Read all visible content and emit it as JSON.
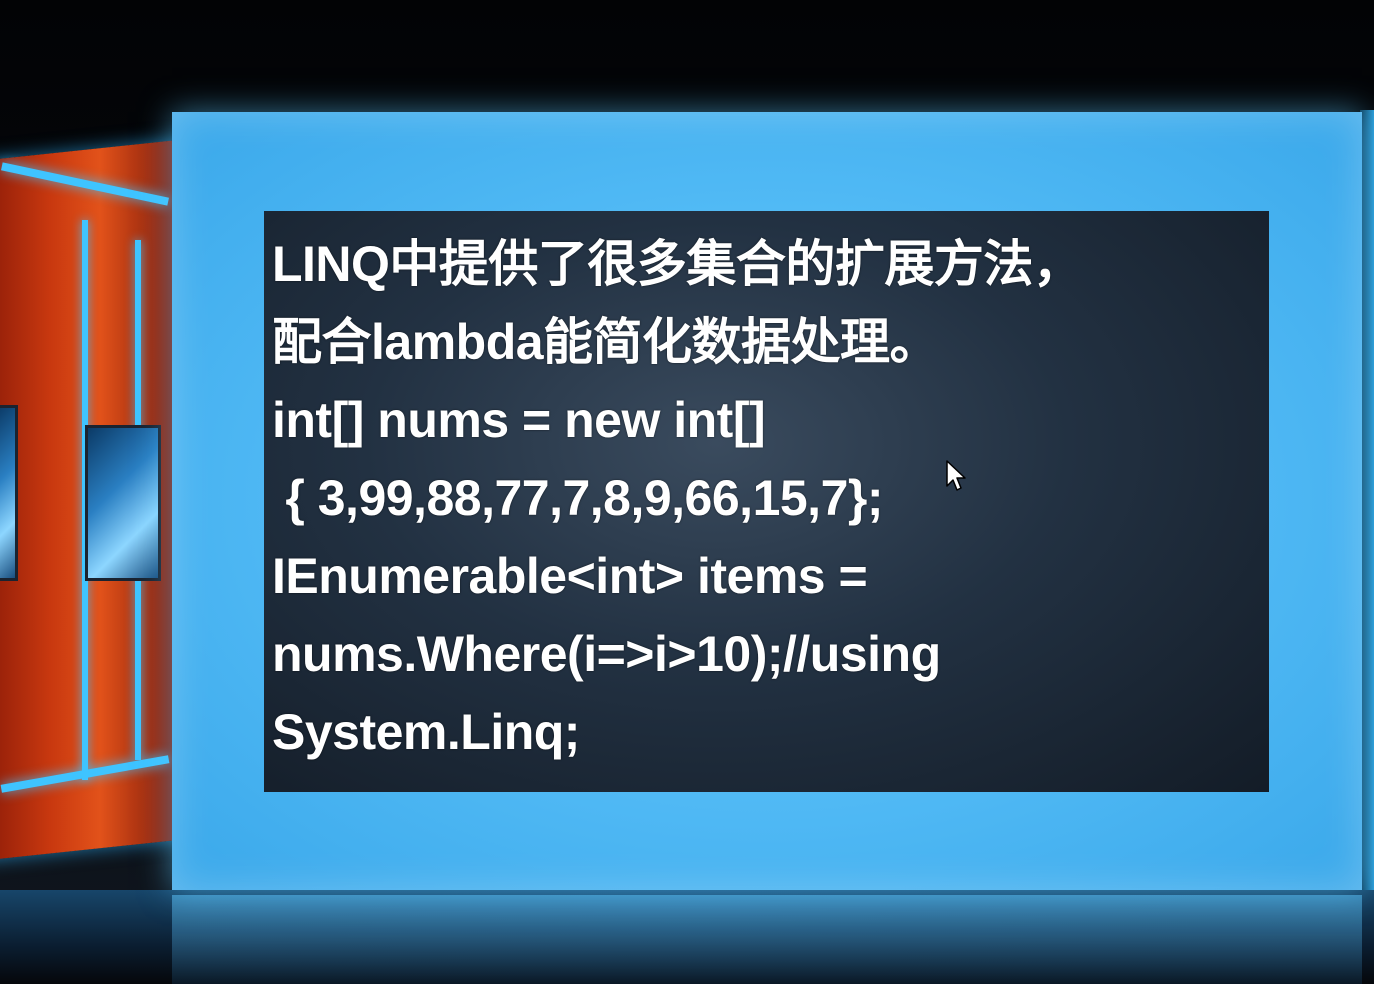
{
  "slide": {
    "lines": [
      "LINQ中提供了很多集合的扩展方法，",
      "配合lambda能简化数据处理。",
      "int[] nums = new int[]",
      " { 3,99,88,77,7,8,9,66,15,7};",
      "IEnumerable<int> items =",
      "nums.Where(i=>i>10);//using",
      "System.Linq;"
    ]
  },
  "colors": {
    "frame": "#55bdf7",
    "slide_background": "#223142",
    "text": "#ffffff",
    "accent_wall": "#c8380f"
  },
  "icons": {
    "cursor": "mouse-pointer-icon"
  }
}
